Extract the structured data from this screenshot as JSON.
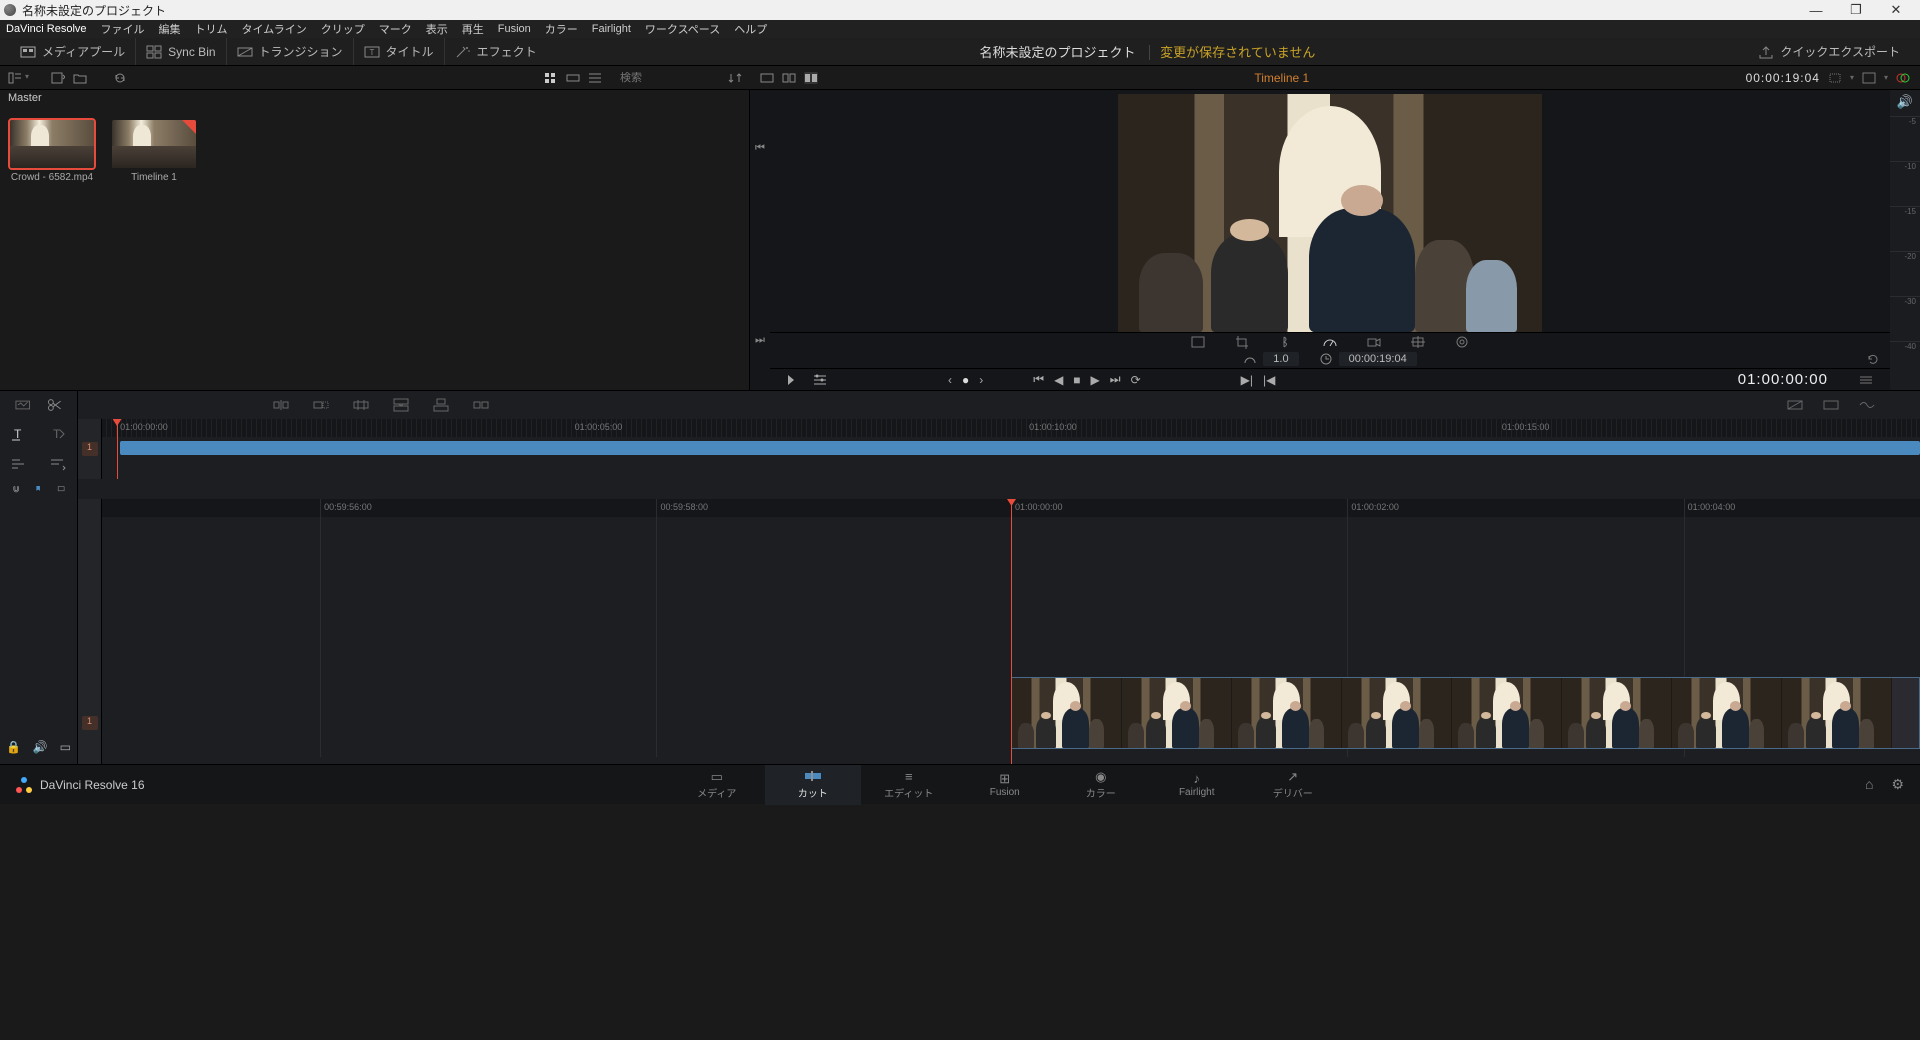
{
  "window": {
    "title": "名称未設定のプロジェクト"
  },
  "menu": {
    "app": "DaVinci Resolve",
    "items": [
      "ファイル",
      "編集",
      "トリム",
      "タイムライン",
      "クリップ",
      "マーク",
      "表示",
      "再生",
      "Fusion",
      "カラー",
      "Fairlight",
      "ワークスペース",
      "ヘルプ"
    ]
  },
  "toolbar": {
    "media_pool": "メディアプール",
    "sync_bin": "Sync Bin",
    "transitions": "トランジション",
    "titles": "タイトル",
    "effects": "エフェクト",
    "project_name": "名称未設定のプロジェクト",
    "unsaved_msg": "変更が保存されていません",
    "quick_export": "クイックエクスポート"
  },
  "row2": {
    "search_placeholder": "検索",
    "timeline_name": "Timeline 1",
    "timecode": "00:00:19:04"
  },
  "pool": {
    "breadcrumb": "Master",
    "clips": [
      {
        "name": "Crowd - 6582.mp4",
        "type": "video",
        "selected": true
      },
      {
        "name": "Timeline 1",
        "type": "timeline",
        "selected": false
      }
    ]
  },
  "viewer": {
    "meter_ticks": [
      "-5",
      "-10",
      "-15",
      "-20",
      "-30",
      "-40"
    ],
    "speed_value": "1.0",
    "duration_tc": "00:00:19:04",
    "transport_tc": "01:00:00:00"
  },
  "timeline_upper": {
    "track_num": "1",
    "ruler": [
      {
        "pos": 1,
        "label": "01:00:00:00"
      },
      {
        "pos": 26,
        "label": "01:00:05:00"
      },
      {
        "pos": 51,
        "label": "01:00:10:00"
      },
      {
        "pos": 77,
        "label": "01:00:15:00"
      }
    ],
    "playhead_pct": 0.8,
    "clip_start_pct": 1.0,
    "clip_end_pct": 100
  },
  "timeline_lower": {
    "track_num": "1",
    "ruler": [
      {
        "pos": 12,
        "label": "00:59:56:00"
      },
      {
        "pos": 30.5,
        "label": "00:59:58:00"
      },
      {
        "pos": 50,
        "label": "01:00:00:00"
      },
      {
        "pos": 68.5,
        "label": "01:00:02:00"
      },
      {
        "pos": 87,
        "label": "01:00:04:00"
      }
    ],
    "playhead_pct": 50,
    "clip_start_pct": 50
  },
  "pages": {
    "brand": "DaVinci Resolve 16",
    "items": [
      "メディア",
      "カット",
      "エディット",
      "Fusion",
      "カラー",
      "Fairlight",
      "デリバー"
    ],
    "active_index": 1
  }
}
